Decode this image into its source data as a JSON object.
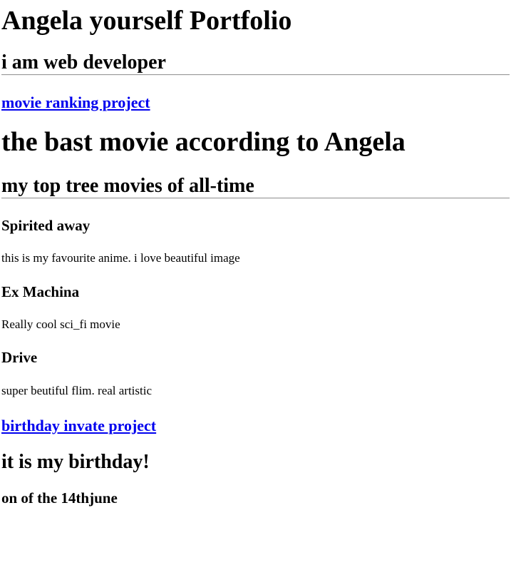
{
  "header": {
    "title": "Angela yourself Portfolio",
    "subtitle": "i am web developer"
  },
  "projects": {
    "movie_link": "movie ranking project",
    "birthday_link": "birthday invate project"
  },
  "movies": {
    "title": "the bast movie according to Angela",
    "subtitle": "my top tree movies of all-time",
    "items": [
      {
        "name": "Spirited away",
        "description": "this is my favourite anime. i love beautiful image"
      },
      {
        "name": "Ex Machina",
        "description": "Really cool sci_fi movie"
      },
      {
        "name": "Drive",
        "description": "super beutiful flim. real artistic"
      }
    ]
  },
  "birthday": {
    "title": "it is my birthday!",
    "subtitle": "on of the 14thjune"
  },
  "colors": {
    "link": "#0000ee",
    "text": "#000000",
    "rule": "#9a9a9a"
  }
}
